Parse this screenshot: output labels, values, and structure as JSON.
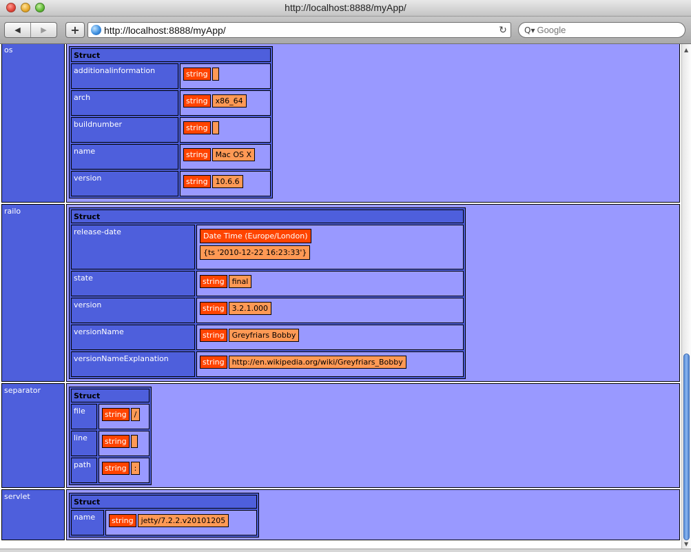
{
  "window": {
    "title": "http://localhost:8888/myApp/"
  },
  "toolbar": {
    "back_glyph": "◀",
    "forward_glyph": "▶",
    "add_glyph": "+",
    "url": "http://localhost:8888/myApp/",
    "reload_glyph": "↻",
    "search_glyph": "Q▾",
    "search_placeholder": "Google"
  },
  "dump": {
    "os": {
      "key": "os",
      "header": "Struct",
      "rows": [
        {
          "key": "additionalinformation",
          "type": "string",
          "value": ""
        },
        {
          "key": "arch",
          "type": "string",
          "value": "x86_64"
        },
        {
          "key": "buildnumber",
          "type": "string",
          "value": ""
        },
        {
          "key": "name",
          "type": "string",
          "value": "Mac OS X"
        },
        {
          "key": "version",
          "type": "string",
          "value": "10.6.6"
        }
      ]
    },
    "railo": {
      "key": "railo",
      "header": "Struct",
      "release_date": {
        "key": "release-date",
        "type": "Date Time (Europe/London)",
        "value": "{ts '2010-12-22 16:23:33'}"
      },
      "rows": [
        {
          "key": "state",
          "type": "string",
          "value": "final"
        },
        {
          "key": "version",
          "type": "string",
          "value": "3.2.1.000"
        },
        {
          "key": "versionName",
          "type": "string",
          "value": "Greyfriars Bobby"
        },
        {
          "key": "versionNameExplanation",
          "type": "string",
          "value": "http://en.wikipedia.org/wiki/Greyfriars_Bobby"
        }
      ]
    },
    "separator": {
      "key": "separator",
      "header": "Struct",
      "rows": [
        {
          "key": "file",
          "type": "string",
          "value": "/"
        },
        {
          "key": "line",
          "type": "string",
          "value": ""
        },
        {
          "key": "path",
          "type": "string",
          "value": ":"
        }
      ]
    },
    "servlet": {
      "key": "servlet",
      "header": "Struct",
      "rows": [
        {
          "key": "name",
          "type": "string",
          "value": "jetty/7.2.2.v20101205"
        }
      ]
    }
  },
  "colors": {
    "key_cell": "#4e5fdc",
    "value_cell": "#9999ff",
    "type_label": "#ff4400",
    "string_value": "#ff9955"
  }
}
